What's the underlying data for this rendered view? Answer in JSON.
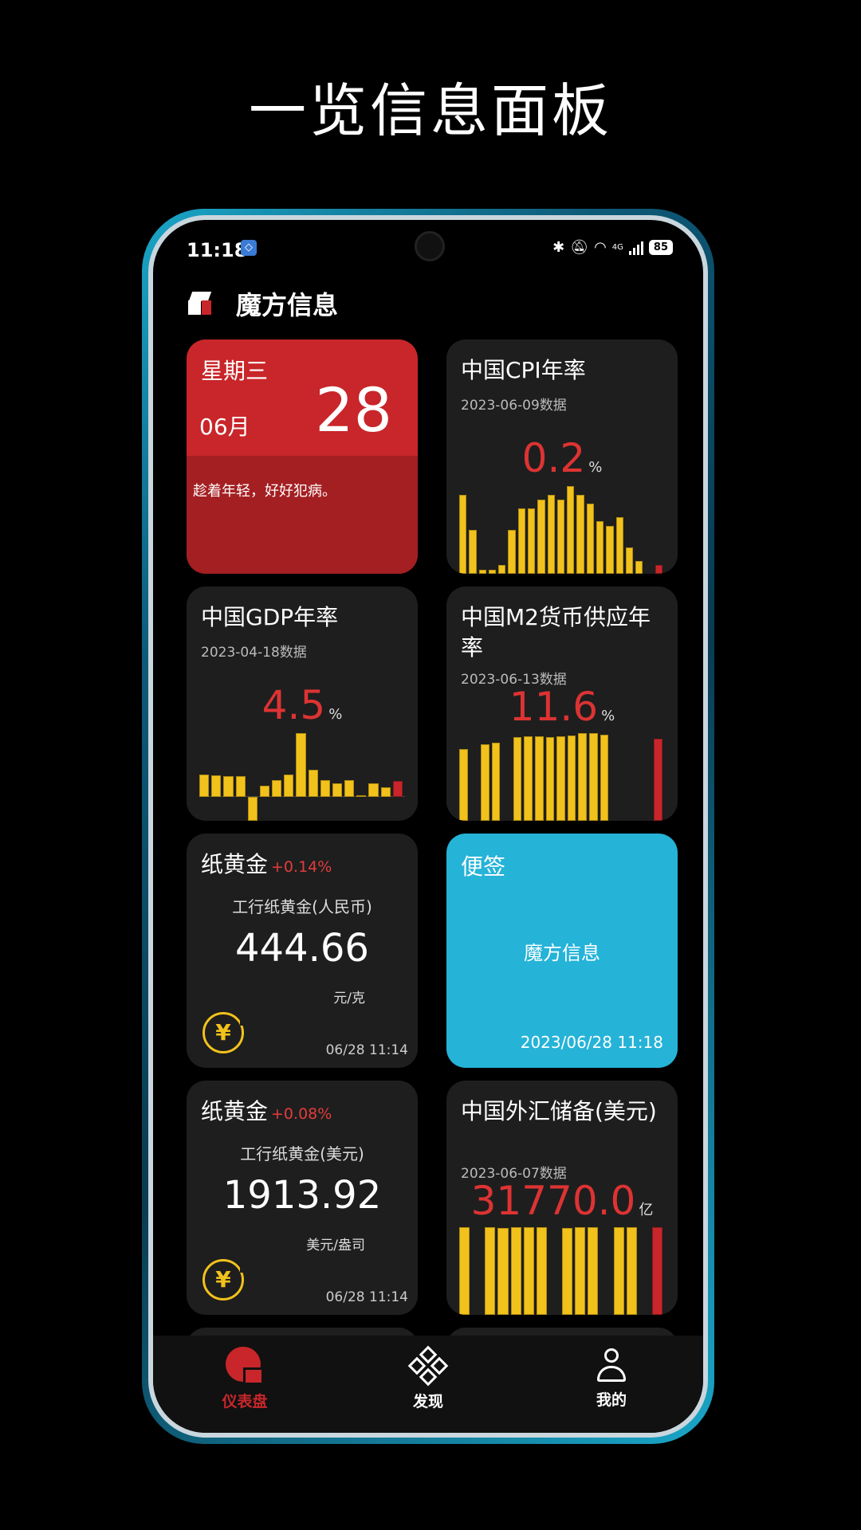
{
  "banner": {
    "title": "一览信息面板"
  },
  "status_bar": {
    "time": "11:18",
    "battery": "85",
    "network": "4G"
  },
  "app": {
    "title": "魔方信息"
  },
  "cards": {
    "date": {
      "weekday": "星期三",
      "month": "06月",
      "day": "28",
      "quote": "趁着年轻，好好犯病。"
    },
    "cpi": {
      "title": "中国CPI年率",
      "subtitle": "2023-06-09数据",
      "value": "0.2",
      "unit": "%",
      "chart_data": {
        "type": "bar",
        "values": [
          1.8,
          1.0,
          0.1,
          0.1,
          0.2,
          1.0,
          1.5,
          1.5,
          1.7,
          1.8,
          1.7,
          2.0,
          1.8,
          1.6,
          1.2,
          1.1,
          1.3,
          0.6,
          0.3,
          0.0,
          0.2
        ],
        "highlight_last": true,
        "colors": {
          "bar": "#f2c21c",
          "latest": "#c8262a"
        }
      }
    },
    "gdp": {
      "title": "中国GDP年率",
      "subtitle": "2023-04-18数据",
      "value": "4.5",
      "unit": "%",
      "chart_data": {
        "type": "bar",
        "values": [
          6.4,
          6.2,
          6.0,
          6.0,
          -6.8,
          3.2,
          4.9,
          6.5,
          18.3,
          7.9,
          4.9,
          4.0,
          4.8,
          0.4,
          3.9,
          2.9,
          4.5
        ],
        "highlight_last": true,
        "colors": {
          "bar": "#f2c21c",
          "latest": "#c8262a"
        }
      }
    },
    "m2": {
      "title": "中国M2货币供应年率",
      "subtitle": "2023-06-13数据",
      "value": "11.6",
      "unit": "%",
      "chart_data": {
        "type": "bar",
        "values": [
          10.1,
          0,
          10.8,
          11.0,
          0,
          11.8,
          12.0,
          11.9,
          11.8,
          12.0,
          12.1,
          12.4,
          12.4,
          12.2,
          0,
          0,
          0,
          0,
          11.6
        ],
        "highlight_last": true,
        "colors": {
          "bar": "#f2c21c",
          "latest": "#c8262a"
        }
      }
    },
    "gold_cny": {
      "title": "纸黄金",
      "change": "+0.14%",
      "name": "工行纸黄金(人民币)",
      "price": "444.66",
      "unit": "元/克",
      "time": "06/28 11:14"
    },
    "note": {
      "title": "便签",
      "body": "魔方信息",
      "time": "2023/06/28 11:18"
    },
    "gold_usd": {
      "title": "纸黄金",
      "change": "+0.08%",
      "name": "工行纸黄金(美元)",
      "price": "1913.92",
      "unit": "美元/盎司",
      "time": "06/28 11:14"
    },
    "fx": {
      "title": "中国外汇储备(美元)",
      "subtitle": "2023-06-07数据",
      "value": "31770.0",
      "unit": "亿",
      "chart_data": {
        "type": "bar",
        "values": [
          31900,
          0,
          31800,
          31750,
          31780,
          31760,
          31800,
          0,
          31720,
          31830,
          31800,
          0,
          31820,
          31840,
          0,
          31770
        ],
        "highlight_last": true,
        "colors": {
          "bar": "#f2c21c",
          "latest": "#c8262a"
        }
      }
    }
  },
  "tabs": [
    {
      "label": "仪表盘",
      "icon": "dashboard-icon",
      "active": true
    },
    {
      "label": "发现",
      "icon": "discover-icon",
      "active": false
    },
    {
      "label": "我的",
      "icon": "user-icon",
      "active": false
    }
  ],
  "colors": {
    "accent": "#c8262a",
    "card": "#1e1e1e",
    "note": "#25b3d8",
    "bar": "#f2c21c"
  }
}
